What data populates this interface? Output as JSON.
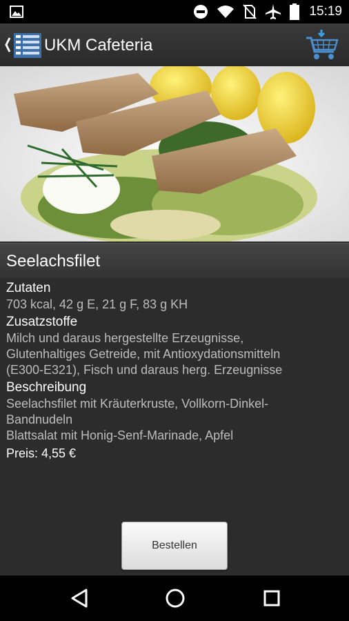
{
  "status_bar": {
    "time": "15:19",
    "icons": [
      "image-icon",
      "do-not-disturb-icon",
      "wifi-icon",
      "no-sim-icon",
      "airplane-icon",
      "battery-icon"
    ]
  },
  "action_bar": {
    "title": "UKM Cafeteria",
    "nav_icon": "drawer-menu-icon",
    "cart_icon": "shopping-cart-icon"
  },
  "dish": {
    "name": "Seelachsfilet",
    "sections": [
      {
        "heading": "Zutaten",
        "lines": [
          "703 kcal, 42 g E, 21 g F, 83 g KH"
        ]
      },
      {
        "heading": "Zusatzstoffe",
        "lines": [
          "Milch und daraus hergestellte Erzeugnisse,",
          "Glutenhaltiges Getreide, mit Antioxydationsmitteln",
          "(E300-E321), Fisch und daraus herg. Erzeugnisse"
        ]
      },
      {
        "heading": "Beschreibung",
        "lines": [
          "Seelachsfilet mit Kräuterkruste, Vollkorn-Dinkel-",
          "Bandnudeln",
          "Blattsalat mit Honig-Senf-Marinade, Apfel"
        ]
      }
    ],
    "price": "Preis: 4,55 €"
  },
  "order_button": {
    "label": "Bestellen"
  },
  "nav_bar": {
    "icons": [
      "back-icon",
      "home-icon",
      "recents-icon"
    ]
  }
}
